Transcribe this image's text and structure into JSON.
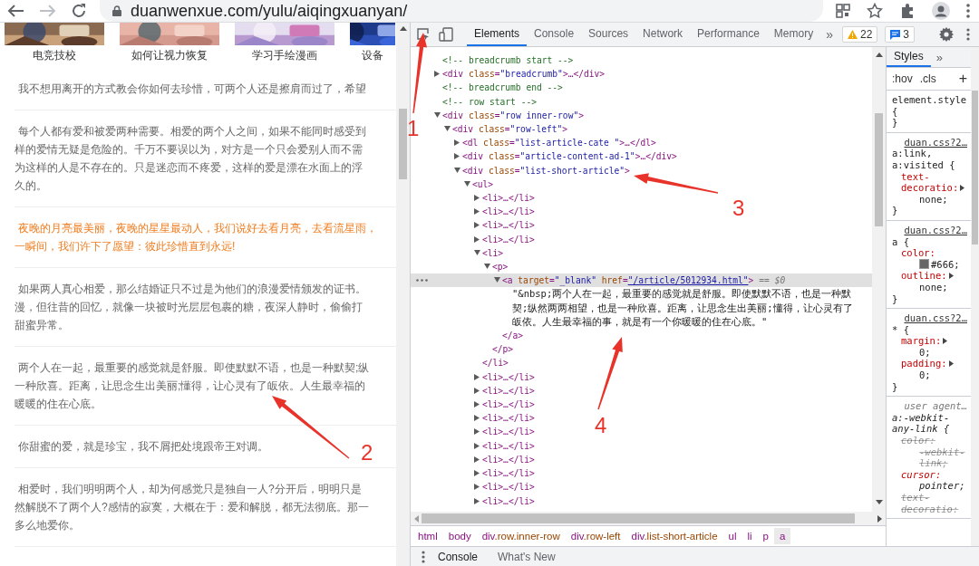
{
  "browser": {
    "address": "duanwenxue.com/yulu/aiqingxuanyan/"
  },
  "page": {
    "thumbnails": [
      {
        "kind": "picture",
        "caption": "电竞技校"
      },
      {
        "kind": "picture",
        "caption": "如何让视力恢复"
      },
      {
        "kind": "picture",
        "caption": "学习手绘漫画"
      },
      {
        "kind": "picture",
        "caption": "设备"
      }
    ],
    "paragraphs": [
      {
        "kind": "normal",
        "lines": [
          "我不想用离开的方式教会你如何去珍惜，可两个人还是擦肩而过了，希望"
        ]
      },
      {
        "kind": "normal",
        "lines": [
          "每个人都有爱和被爱两种需要。相爱的两个人之间，如果不能同时感受到",
          "样的爱情无疑是危险的。千万不要误以为，对方是一个只会爱别人而不需",
          "为这样的人是不存在的。只是迷恋而不疼爱，这样的爱是漂在水面上的浮",
          "久的。"
        ]
      },
      {
        "kind": "highlight",
        "lines": [
          "夜晚的月亮最美丽，夜晚的星星最动人，我们说好去看月亮，去看流星雨，",
          "一瞬间，我们许下了愿望：彼此珍惜直到永远!"
        ]
      },
      {
        "kind": "normal",
        "lines": [
          "如果两人真心相爱，那么结婚证只不过是为他们的浪漫爱情颁发的证书。",
          "漫，但往昔的回忆，就像一块被时光层层包裹的糖，夜深人静时，偷偷打",
          "甜蜜异常。"
        ]
      },
      {
        "kind": "normal",
        "lines": [
          "两个人在一起，最重要的感觉就是舒服。即使默默不语，也是一种默契;纵",
          "一种欣喜。距离，让思念生出美丽;懂得，让心灵有了皈依。人生最幸福的",
          "暖暖的住在心底。"
        ]
      },
      {
        "kind": "normal",
        "lines": [
          "你甜蜜的爱，就是珍宝，我不屑把处境跟帝王对调。"
        ]
      },
      {
        "kind": "normal",
        "lines": [
          "相爱时，我们明明两个人，却为何感觉只是独自一人?分开后，明明只是",
          "然解脱不了两个人?感情的寂寞，大概在于：爱和解脱，都无法彻底。那一",
          "多么地爱你。"
        ]
      }
    ]
  },
  "devtools": {
    "tabs": [
      {
        "label": "Elements",
        "selected": true
      },
      {
        "label": "Console",
        "selected": false
      },
      {
        "label": "Sources",
        "selected": false
      },
      {
        "label": "Network",
        "selected": false
      },
      {
        "label": "Performance",
        "selected": false
      },
      {
        "label": "Memory",
        "selected": false
      }
    ],
    "more": "»",
    "warnings": "22",
    "messages": "3",
    "tree": [
      {
        "kind": "comment",
        "text": "<!-- breadcrumb start -->"
      },
      {
        "kind": "element",
        "text": "<div class=\"breadcrumb\">…</div>",
        "expanded": false,
        "selected": false
      },
      {
        "kind": "comment",
        "text": "<!-- breadcrumb end -->"
      },
      {
        "kind": "comment",
        "text": "<!-- row start -->"
      },
      {
        "kind": "element",
        "text": "<div class=\"row inner-row\">",
        "expanded": true,
        "selected": false,
        "children": [
          {
            "kind": "element",
            "text": "<div class=\"row-left\">",
            "expanded": true,
            "selected": false,
            "children": [
              {
                "kind": "element",
                "text": "<dl class=\"list-article-cate \">…</dl>",
                "expanded": false,
                "selected": false
              },
              {
                "kind": "element",
                "text": "<div class=\"article-content-ad-1\">…</div>",
                "expanded": false,
                "selected": false
              },
              {
                "kind": "element",
                "text": "<div class=\"list-short-article\">",
                "expanded": true,
                "selected": false,
                "children": [
                  {
                    "kind": "element",
                    "text": "<ul>",
                    "expanded": true,
                    "selected": false,
                    "children": [
                      {
                        "kind": "element",
                        "text": "<li>…</li>",
                        "expanded": false,
                        "selected": false
                      },
                      {
                        "kind": "element",
                        "text": "<li>…</li>",
                        "expanded": false,
                        "selected": false
                      },
                      {
                        "kind": "element",
                        "text": "<li>…</li>",
                        "expanded": false,
                        "selected": false
                      },
                      {
                        "kind": "element",
                        "text": "<li>…</li>",
                        "expanded": false,
                        "selected": false
                      },
                      {
                        "kind": "element",
                        "text": "<li>",
                        "expanded": true,
                        "selected": false,
                        "close": "</li>",
                        "children": [
                          {
                            "kind": "element",
                            "text": "<p>",
                            "expanded": true,
                            "selected": false,
                            "close": "</p>",
                            "children": [
                              {
                                "kind": "element",
                                "text": "<a target=\"_blank\" href=\"/article/5012934.html\">",
                                "suffix": "== $0",
                                "expanded": true,
                                "selected": true,
                                "close": "</a>",
                                "children": [
                                  {
                                    "kind": "text",
                                    "text": "\"&nbsp;两个人在一起，最重要的感觉就是舒服。即使默默不语，也是一种默契;纵然两两相望，也是一种欣喜。距离，让思念生出美丽;懂得，让心灵有了皈依。人生最幸福的事，就是有一个你暖暖的住在心底。\""
                                  }
                                ]
                              }
                            ]
                          }
                        ]
                      },
                      {
                        "kind": "element",
                        "text": "<li>…</li>",
                        "expanded": false,
                        "selected": false
                      },
                      {
                        "kind": "element",
                        "text": "<li>…</li>",
                        "expanded": false,
                        "selected": false
                      },
                      {
                        "kind": "element",
                        "text": "<li>…</li>",
                        "expanded": false,
                        "selected": false
                      },
                      {
                        "kind": "element",
                        "text": "<li>…</li>",
                        "expanded": false,
                        "selected": false
                      },
                      {
                        "kind": "element",
                        "text": "<li>…</li>",
                        "expanded": false,
                        "selected": false
                      },
                      {
                        "kind": "element",
                        "text": "<li>…</li>",
                        "expanded": false,
                        "selected": false
                      },
                      {
                        "kind": "element",
                        "text": "<li>…</li>",
                        "expanded": false,
                        "selected": false
                      },
                      {
                        "kind": "element",
                        "text": "<li>…</li>",
                        "expanded": false,
                        "selected": false
                      },
                      {
                        "kind": "element",
                        "text": "<li>…</li>",
                        "expanded": false,
                        "selected": false
                      },
                      {
                        "kind": "element",
                        "text": "<li>…</li>",
                        "expanded": false,
                        "selected": false
                      }
                    ]
                  }
                ]
              }
            ]
          }
        ]
      }
    ],
    "breadcrumb": [
      {
        "label": "html",
        "selected": false
      },
      {
        "label": "body",
        "selected": false
      },
      {
        "label": "div.row.inner-row",
        "selected": false
      },
      {
        "label": "div.row-left",
        "selected": false
      },
      {
        "label": "div.list-short-article",
        "selected": false
      },
      {
        "label": "ul",
        "selected": false
      },
      {
        "label": "li",
        "selected": false
      },
      {
        "label": "p",
        "selected": false
      },
      {
        "label": "a",
        "selected": true
      }
    ],
    "styles": {
      "tabs": [
        {
          "label": "Styles",
          "selected": true
        }
      ],
      "more": "»",
      "filters": [
        ":hov",
        ".cls"
      ],
      "add": "+",
      "rules": [
        {
          "kind": "inline",
          "selector": "element.style {",
          "close": "}"
        },
        {
          "kind": "author",
          "source": "duan.css?2…",
          "selector": "a:link, a:visited {",
          "props": [
            {
              "name": "text-decoratio:",
              "value": "none;",
              "expandable": true,
              "overridden": false
            }
          ],
          "close": "}"
        },
        {
          "kind": "author",
          "source": "duan.css?2…",
          "selector": "a {",
          "props": [
            {
              "name": "color:",
              "value": "#666;",
              "overridden": false
            },
            {
              "name": "outline:",
              "value": "none;",
              "expandable": true,
              "overridden": false
            }
          ],
          "close": "}"
        },
        {
          "kind": "author",
          "source": "duan.css?2…",
          "selector": "* {",
          "props": [
            {
              "name": "margin:",
              "value": "0;",
              "expandable": true,
              "overridden": false
            },
            {
              "name": "padding:",
              "value": "0;",
              "expandable": true,
              "overridden": false
            }
          ],
          "close": "}"
        },
        {
          "kind": "user-agent",
          "source": "user agent…",
          "selector": "a:-webkit-any-link {",
          "props": [
            {
              "name": "color:",
              "value": "-webkit-link;",
              "overridden": true
            },
            {
              "name": "cursor:",
              "value": "pointer;",
              "overridden": false
            },
            {
              "name": "text-decoratio:",
              "overridden": true
            }
          ]
        }
      ]
    },
    "drawer": [
      {
        "label": "Console",
        "selected": true
      },
      {
        "label": "What's New",
        "selected": false
      }
    ]
  },
  "annotations": [
    {
      "label": "1"
    },
    {
      "label": "2"
    },
    {
      "label": "3"
    },
    {
      "label": "4"
    }
  ]
}
